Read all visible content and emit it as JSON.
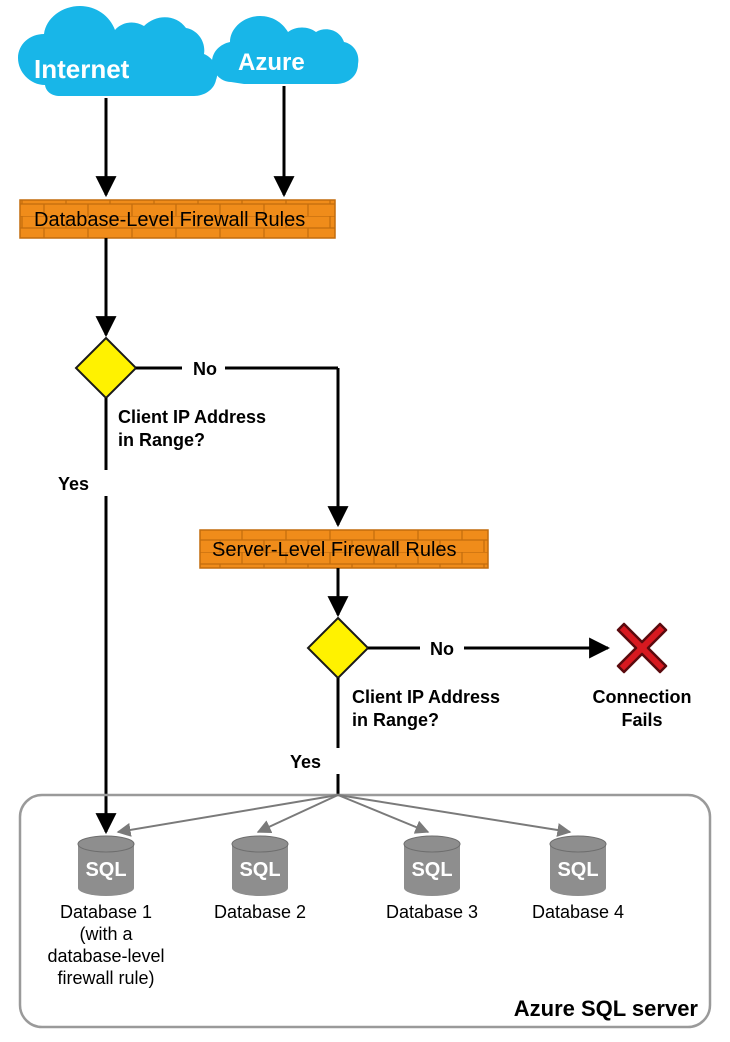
{
  "clouds": {
    "internet": "Internet",
    "azure": "Azure"
  },
  "rules": {
    "database_level": "Database-Level Firewall Rules",
    "server_level": "Server-Level Firewall Rules"
  },
  "decision": {
    "question_line1": "Client IP Address",
    "question_line2": "in Range?",
    "yes": "Yes",
    "no": "No"
  },
  "fail": {
    "line1": "Connection",
    "line2": "Fails"
  },
  "server": {
    "title": "Azure SQL server"
  },
  "databases": {
    "sql_label": "SQL",
    "db1_line1": "Database 1",
    "db1_line2": "(with a",
    "db1_line3": "database-level",
    "db1_line4": "firewall rule)",
    "db2": "Database 2",
    "db3": "Database 3",
    "db4": "Database 4"
  },
  "colors": {
    "cloud": "#18B6E8",
    "brick_fill": "#F08C1A",
    "brick_stroke": "#C26C0D",
    "diamond_fill": "#FFF200",
    "diamond_stroke": "#1A1A1A",
    "x_red": "#D71920",
    "db_gray": "#8E8E8E",
    "server_border": "#9A9A9A"
  }
}
